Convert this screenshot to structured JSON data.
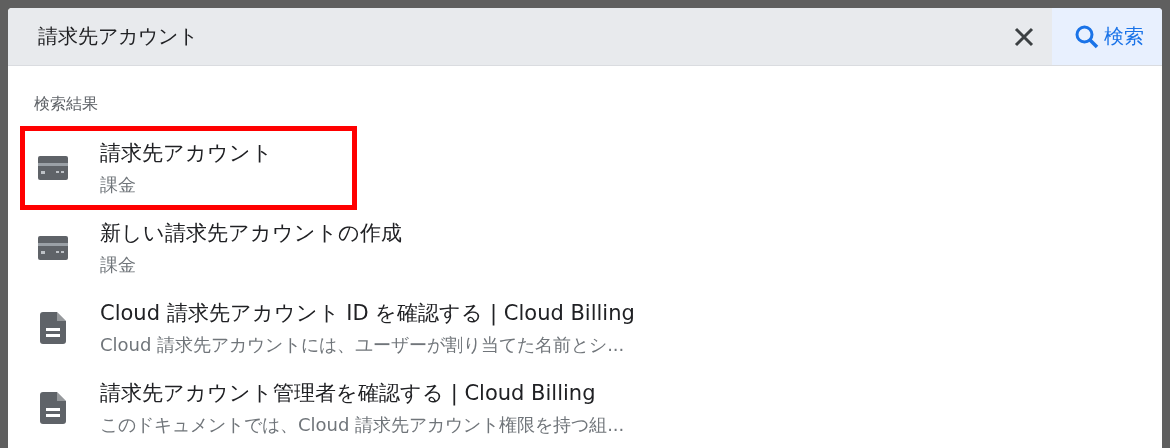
{
  "search": {
    "value": "請求先アカウント",
    "search_button": "検索"
  },
  "results": {
    "heading": "検索結果",
    "items": [
      {
        "kind": "billing",
        "title": "請求先アカウント",
        "subtitle": "課金",
        "highlighted": true
      },
      {
        "kind": "billing",
        "title": "新しい請求先アカウントの作成",
        "subtitle": "課金",
        "highlighted": false
      },
      {
        "kind": "doc",
        "title": "Cloud 請求先アカウント ID を確認する | Cloud Billing",
        "subtitle": "Cloud 請求先アカウントには、ユーザーが割り当てた名前とシ...",
        "highlighted": false
      },
      {
        "kind": "doc",
        "title": "請求先アカウント管理者を確認する | Cloud Billing",
        "subtitle": "このドキュメントでは、Cloud 請求先アカウント権限を持つ組...",
        "highlighted": false
      }
    ]
  }
}
